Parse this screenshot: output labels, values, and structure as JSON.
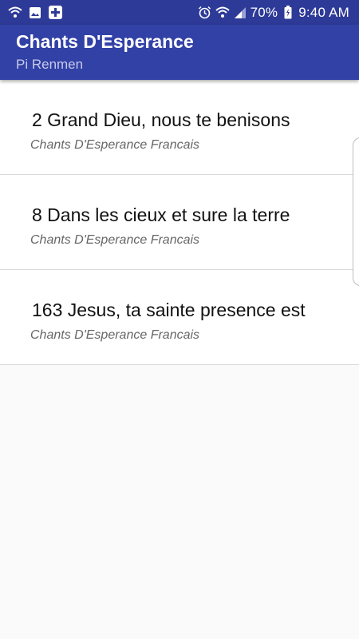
{
  "status_bar": {
    "battery": "70%",
    "time": "9:40 AM",
    "icons_left": [
      "wifi-signal-icon",
      "image-icon",
      "medical-cross-icon"
    ],
    "icons_right": [
      "alarm-icon",
      "wifi-icon",
      "cell-signal-icon",
      "battery-charging-icon"
    ]
  },
  "toolbar": {
    "title": "Chants D'Esperance",
    "subtitle": "Pi Renmen"
  },
  "songs": [
    {
      "title": "2 Grand Dieu, nous te benisons",
      "book": "Chants D'Esperance Francais"
    },
    {
      "title": "8 Dans les cieux et sure la terre",
      "book": "Chants D'Esperance Francais"
    },
    {
      "title": "163 Jesus, ta sainte presence est",
      "book": "Chants D'Esperance Francais"
    }
  ],
  "colors": {
    "status_bar": "#2d3a97",
    "toolbar": "#3241a6",
    "subtitle": "#c7cbec",
    "background": "#fafafa"
  }
}
